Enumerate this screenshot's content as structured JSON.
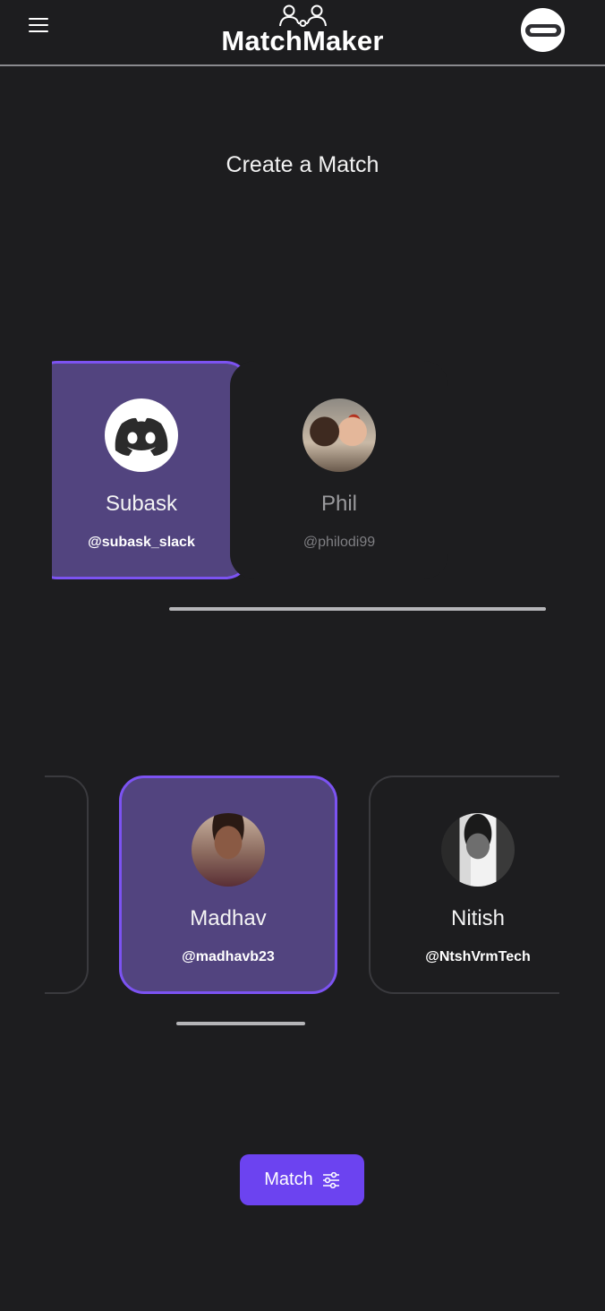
{
  "header": {
    "app_name": "MatchMaker",
    "menu_icon": "menu-icon",
    "logo_icon": "users-link-icon",
    "profile_icon": "controller-icon"
  },
  "page": {
    "title": "Create a Match"
  },
  "first_carousel": {
    "cards": [
      {
        "name": "Subask",
        "handle": "@subask_slack",
        "avatar": "discord-logo",
        "selected": true
      },
      {
        "name": "Phil",
        "handle": "@philodi99",
        "avatar": "photo-two-children",
        "selected": false
      }
    ]
  },
  "second_carousel": {
    "cards": [
      {
        "name": "Madhav",
        "handle": "@madhavb23",
        "avatar": "photo-man",
        "selected": true
      },
      {
        "name": "Nitish",
        "handle": "@NtshVrmTech",
        "avatar": "photo-man-bw",
        "selected": false
      }
    ]
  },
  "match_button": {
    "label": "Match",
    "icon": "sliders-icon"
  },
  "colors": {
    "background": "#1d1d1f",
    "accent": "#7c53f2",
    "selected_card": "#52447f",
    "button": "#6c43f0"
  }
}
